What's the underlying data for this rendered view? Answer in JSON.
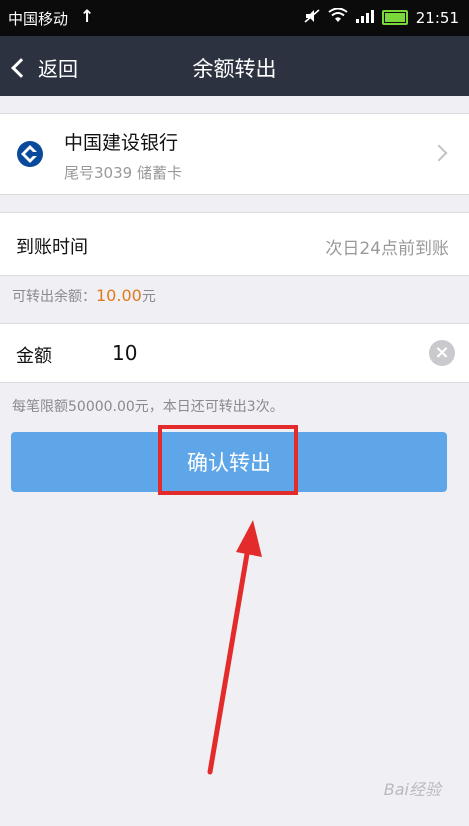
{
  "status_bar": {
    "carrier": "中国移动",
    "time": "21:51",
    "icons": [
      "upload-arrow-icon",
      "mute-icon",
      "wifi-icon",
      "signal-icon",
      "battery-icon"
    ]
  },
  "nav": {
    "back_label": "返回",
    "title": "余额转出"
  },
  "bank": {
    "name": "中国建设银行",
    "sub": "尾号3039 储蓄卡",
    "logo_color": "#0a4a9c"
  },
  "arrival": {
    "label": "到账时间",
    "value": "次日24点前到账"
  },
  "balance": {
    "label": "可转出余额：",
    "amount": "10.00",
    "unit": "元",
    "color": "#e07a1f"
  },
  "amount": {
    "label": "金额",
    "value": "10"
  },
  "limit_note": "每笔限额50000.00元，本日还可转出3次。",
  "confirm": {
    "label": "确认转出",
    "color": "#5ea6e8"
  },
  "annotation": {
    "highlight_color": "#e32b2b"
  },
  "watermark": "Bai经验"
}
